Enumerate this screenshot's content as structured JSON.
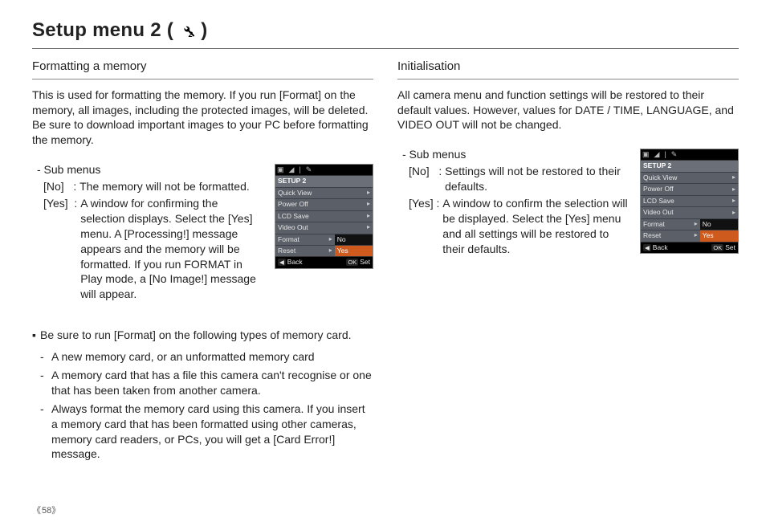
{
  "page": {
    "title_prefix": "Setup menu 2 (",
    "title_suffix": ")",
    "number_display": "58"
  },
  "left": {
    "heading": "Formatting a memory",
    "intro": "This is used for formatting the memory. If you run [Format] on the memory, all images, including the protected images, will be deleted. Be sure to download important images to your PC before formatting the memory.",
    "sub_menus_label": "- Sub menus",
    "options": [
      {
        "key": "[No]   : ",
        "desc": "The memory will not be formatted."
      },
      {
        "key": "[Yes]  : ",
        "desc": "A window for confirming the selection displays. Select the [Yes] menu. A [Processing!] message appears and the memory will be formatted. If you run FORMAT in Play mode, a [No Image!] message will appear."
      }
    ],
    "note_lead": "Be sure to run [Format] on the following types of memory card.",
    "bullets": [
      "A new memory card, or an unformatted memory card",
      "A memory card that has a file this camera can't recognise or one that has been taken from another camera.",
      "Always format the memory card using this camera. If you insert a memory card that has been formatted using other cameras, memory card readers, or PCs, you will get a [Card Error!] message."
    ],
    "lcd": {
      "title": "SETUP 2",
      "rows": [
        "Quick View",
        "Power Off",
        "LCD Save",
        "Video Out"
      ],
      "split": [
        {
          "l": "Format",
          "r": "No",
          "hl": false
        },
        {
          "l": "Reset",
          "r": "Yes",
          "hl": true
        }
      ],
      "foot_back": "Back",
      "foot_set": "Set",
      "foot_back_key": "◀",
      "foot_set_key": "OK"
    }
  },
  "right": {
    "heading": "Initialisation",
    "intro": "All camera menu and function settings will be restored to their default values. However, values for DATE / TIME, LANGUAGE, and VIDEO OUT will not be changed.",
    "sub_menus_label": "- Sub menus",
    "options": [
      {
        "key": "[No]   : ",
        "desc": "Settings will not be restored to their defaults."
      },
      {
        "key": "[Yes] : ",
        "desc": "A window to confirm the selection will be displayed. Select the [Yes] menu and all settings will be restored to their defaults."
      }
    ],
    "lcd": {
      "title": "SETUP 2",
      "rows": [
        "Quick View",
        "Power Off",
        "LCD Save",
        "Video Out"
      ],
      "split": [
        {
          "l": "Format",
          "r": "No",
          "hl": false
        },
        {
          "l": "Reset",
          "r": "Yes",
          "hl": true
        }
      ],
      "foot_back": "Back",
      "foot_set": "Set",
      "foot_back_key": "◀",
      "foot_set_key": "OK"
    }
  }
}
